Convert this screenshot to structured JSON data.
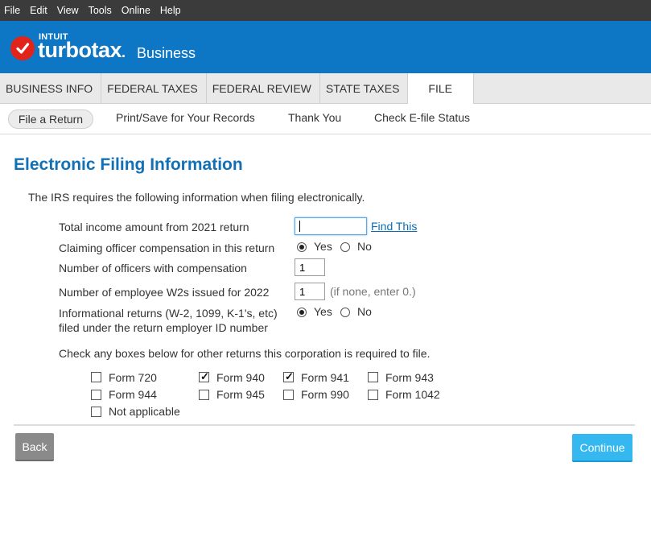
{
  "menu": [
    "File",
    "Edit",
    "View",
    "Tools",
    "Online",
    "Help"
  ],
  "brand": {
    "intuit": "INTUIT",
    "product": "turbotax",
    "dot": ".",
    "edition": "Business",
    "logo_icon": "checkmark-icon",
    "colors": {
      "bar": "#0d77c5",
      "logo": "#e2231a"
    }
  },
  "tabs": [
    "BUSINESS INFO",
    "FEDERAL TAXES",
    "FEDERAL REVIEW",
    "STATE TAXES",
    "FILE"
  ],
  "active_tab": "FILE",
  "subnav": [
    "File a Return",
    "Print/Save for Your Records",
    "Thank You",
    "Check E-file Status"
  ],
  "page": {
    "title": "Electronic Filing Information",
    "intro": "The IRS requires the following information when filing electronically.",
    "total_income": {
      "label": "Total income amount from 2021 return",
      "value": "",
      "link": "Find This"
    },
    "officer_comp": {
      "label": "Claiming officer compensation in this return",
      "yes": "Yes",
      "no": "No",
      "selected": "Yes"
    },
    "num_officers": {
      "label": "Number of officers with compensation",
      "value": "1"
    },
    "num_w2": {
      "label": "Number of employee W2s issued for 2022",
      "value": "1",
      "hint": "(if none, enter 0.)"
    },
    "info_returns": {
      "label_line1": "Informational returns (W-2, 1099, K-1's, etc)",
      "label_line2": "filed under the return employer ID number",
      "yes": "Yes",
      "no": "No",
      "selected": "Yes"
    },
    "other_returns_label": "Check any boxes below for other returns this corporation is required to file.",
    "forms": [
      {
        "label": "Form 720",
        "checked": false
      },
      {
        "label": "Form 940",
        "checked": true
      },
      {
        "label": "Form 941",
        "checked": true
      },
      {
        "label": "Form 943",
        "checked": false
      },
      {
        "label": "Form 944",
        "checked": false
      },
      {
        "label": "Form 945",
        "checked": false
      },
      {
        "label": "Form 990",
        "checked": false
      },
      {
        "label": "Form 1042",
        "checked": false
      },
      {
        "label": "Not applicable",
        "checked": false
      }
    ]
  },
  "buttons": {
    "back": "Back",
    "continue": "Continue"
  }
}
